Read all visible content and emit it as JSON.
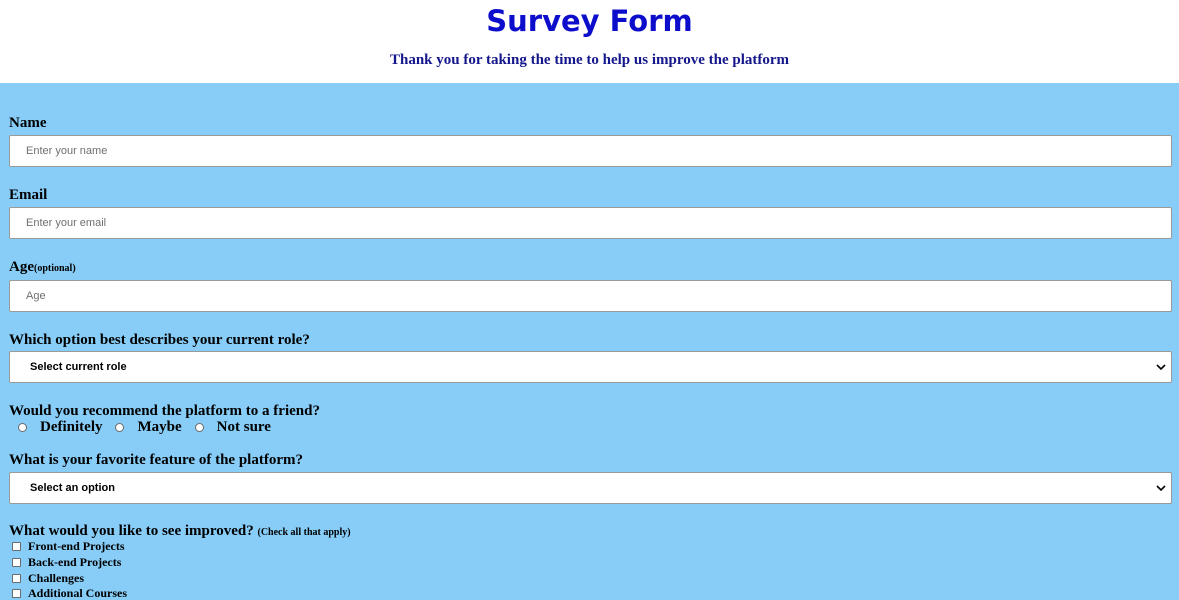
{
  "header": {
    "title": "Survey Form",
    "subtitle": "Thank you for taking the time to help us improve the platform"
  },
  "form": {
    "name": {
      "label": "Name",
      "placeholder": "Enter your name"
    },
    "email": {
      "label": "Email",
      "placeholder": "Enter your email"
    },
    "age": {
      "label": "Age",
      "label_note": "(optional)",
      "placeholder": "Age"
    },
    "role": {
      "label": "Which option best describes your current role?",
      "selected": "Select current role"
    },
    "recommend": {
      "label": "Would you recommend the platform to a friend?",
      "options": [
        "Definitely",
        "Maybe",
        "Not sure"
      ]
    },
    "feature": {
      "label": "What is your favorite feature of the platform?",
      "selected": "Select an option"
    },
    "improve": {
      "label": "What would you like to see improved?",
      "label_note": "(Check all that apply)",
      "options": [
        "Front-end Projects",
        "Back-end Projects",
        "Challenges",
        "Additional Courses"
      ]
    }
  },
  "colors": {
    "title": "#0d0dcc",
    "subtitle": "#14168c",
    "form_background": "#87cdf7"
  },
  "icons": {
    "dropdown": "chevron-down-icon"
  }
}
